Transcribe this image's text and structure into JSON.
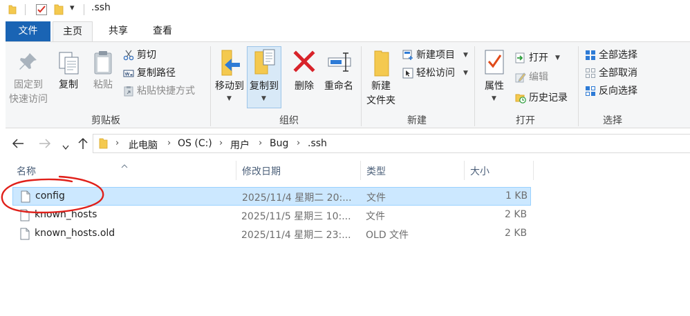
{
  "window": {
    "title": ".ssh"
  },
  "quick_access": {
    "dropdown": "▾"
  },
  "tabs": [
    {
      "label": "文件"
    },
    {
      "label": "主页"
    },
    {
      "label": "共享"
    },
    {
      "label": "查看"
    }
  ],
  "ribbon": {
    "clipboard": {
      "group_label": "剪贴板",
      "pin_line1": "固定到",
      "pin_line2": "快速访问",
      "copy": "复制",
      "paste": "粘贴",
      "cut": "剪切",
      "copy_path": "复制路径",
      "paste_shortcut": "粘贴快捷方式"
    },
    "organize": {
      "group_label": "组织",
      "move_to": "移动到",
      "copy_to": "复制到",
      "delete": "删除",
      "rename": "重命名"
    },
    "new": {
      "group_label": "新建",
      "new_folder_line1": "新建",
      "new_folder_line2": "文件夹",
      "new_item": "新建项目",
      "easy_access": "轻松访问"
    },
    "open": {
      "group_label": "打开",
      "properties": "属性",
      "open": "打开",
      "edit": "编辑",
      "history": "历史记录"
    },
    "select": {
      "group_label": "选择",
      "select_all": "全部选择",
      "select_none": "全部取消",
      "invert": "反向选择"
    }
  },
  "breadcrumb": [
    "此电脑",
    "OS (C:)",
    "用户",
    "Bug",
    ".ssh"
  ],
  "columns": {
    "name": "名称",
    "modified": "修改日期",
    "type": "类型",
    "size": "大小"
  },
  "files": [
    {
      "name": "config",
      "modified": "2025/11/4 星期二 20:...",
      "type": "文件",
      "size": "1 KB",
      "selected": true
    },
    {
      "name": "known_hosts",
      "modified": "2025/11/5 星期三 10:...",
      "type": "文件",
      "size": "2 KB",
      "selected": false
    },
    {
      "name": "known_hosts.old",
      "modified": "2025/11/4 星期二 23:...",
      "type": "OLD 文件",
      "size": "2 KB",
      "selected": false
    }
  ],
  "colors": {
    "file_tab": "#1a64b4",
    "selection_fill": "#cce8ff",
    "selection_border": "#99d1ff",
    "annotation_circle": "#e0201a",
    "folder": "#f4c94f"
  }
}
